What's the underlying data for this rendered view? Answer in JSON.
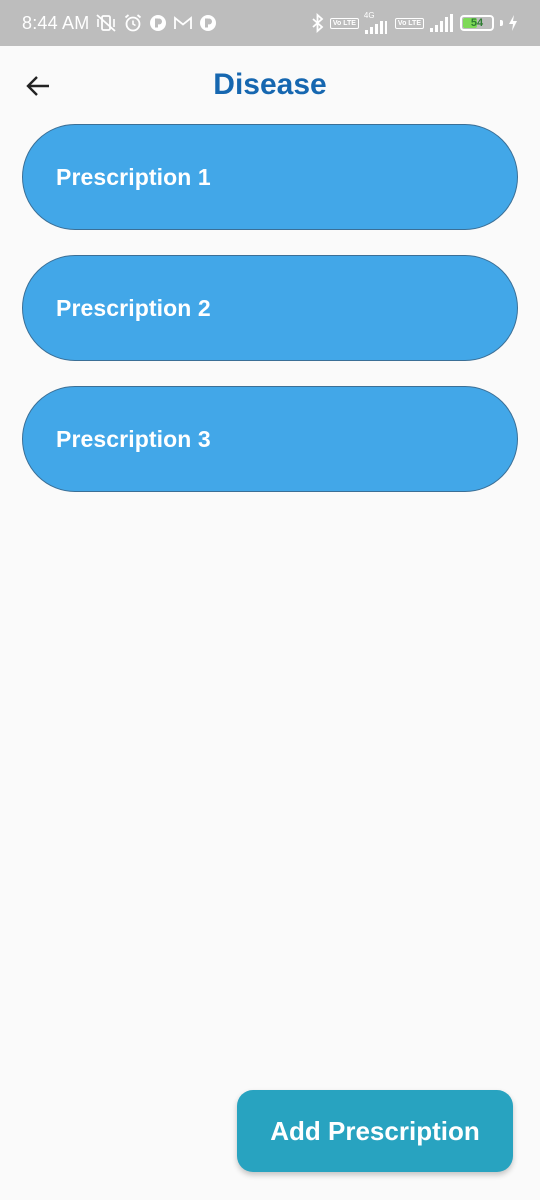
{
  "status_bar": {
    "time": "8:44 AM",
    "network_label": "4G",
    "volte_label_1": "Vo LTE",
    "volte_label_2": "Vo LTE",
    "battery_level": "54",
    "battery_fraction": 0.54,
    "left_icons": [
      "vibrate-off-icon",
      "alarm-icon",
      "app-notification-icon",
      "gmail-icon",
      "app-notification-icon"
    ],
    "right_icons": [
      "bluetooth-icon",
      "signal-icon",
      "signal-icon",
      "charging-icon"
    ]
  },
  "header": {
    "title": "Disease",
    "back_icon": "arrow-left-icon"
  },
  "prescriptions": [
    {
      "label": "Prescription 1"
    },
    {
      "label": "Prescription 2"
    },
    {
      "label": "Prescription 3"
    }
  ],
  "actions": {
    "add_label": "Add Prescription"
  },
  "colors": {
    "title": "#1667b0",
    "card": "#42a7e8",
    "card_border": "#3b6f96",
    "add_button": "#28a3c0",
    "status_bar": "#bdbdbd",
    "background": "#fafafa"
  }
}
